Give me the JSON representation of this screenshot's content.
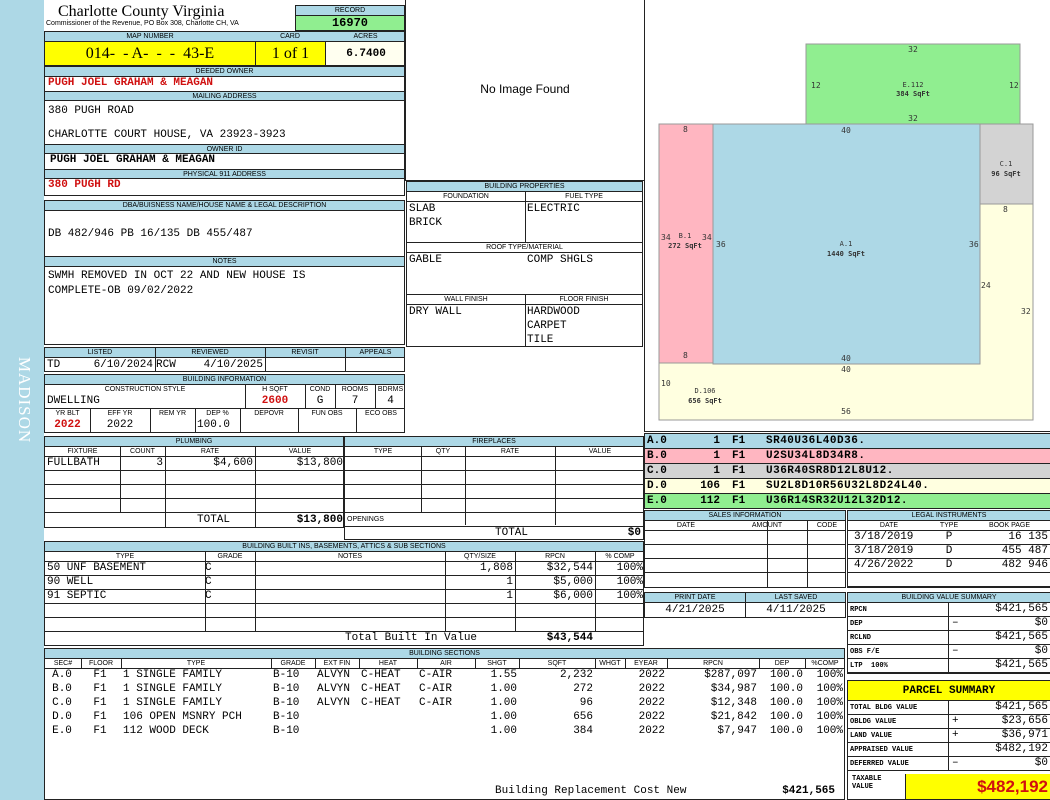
{
  "sidebar": {
    "district": "MADISON"
  },
  "header": {
    "county": "Charlotte County Virginia",
    "office": "Commissioner of the Revenue, PO Box 308, Charlotte CH, VA",
    "record_label": "RECORD",
    "record": "16970",
    "map_label": "MAP NUMBER",
    "map": "014-  - A-  -  -  43-E",
    "card_label": "CARD",
    "card": "1 of 1",
    "acres_label": "ACRES",
    "acres": "6.7400"
  },
  "owner": {
    "deeded_label": "DEEDED OWNER",
    "deeded": "PUGH JOEL GRAHAM & MEAGAN",
    "mailing_label": "MAILING ADDRESS",
    "mail1": "380 PUGH ROAD",
    "mail2": "CHARLOTTE COURT HOUSE, VA 23923-3923",
    "owner_id_label": "OWNER ID",
    "owner_id": "PUGH JOEL GRAHAM & MEAGAN",
    "physical_label": "PHYSICAL 911 ADDRESS",
    "physical": "380 PUGH RD"
  },
  "legal": {
    "label": "DBA/BUISNESS NAME/HOUSE NAME & LEGAL DESCRIPTION",
    "text": "DB 482/946 PB 16/135 DB 455/487"
  },
  "notes": {
    "label": "NOTES",
    "line1": "SWMH REMOVED IN OCT 22 AND NEW HOUSE IS",
    "line2": "COMPLETE-OB 09/02/2022"
  },
  "image": {
    "text": "No Image Found"
  },
  "building_props": {
    "label": "BUILDING PROPERTIES",
    "foundation_label": "FOUNDATION",
    "fuel_label": "FUEL TYPE",
    "foundation1": "SLAB",
    "foundation2": "BRICK",
    "fuel": "ELECTRIC",
    "roof_label": "ROOF TYPE/MATERIAL",
    "roof_type": "GABLE",
    "roof_mat": "COMP SHGLS",
    "wall_label": "WALL FINISH",
    "floor_label": "FLOOR FINISH",
    "wall": "DRY WALL",
    "floor1": "HARDWOOD",
    "floor2": "CARPET",
    "floor3": "TILE"
  },
  "listing": {
    "listed_label": "LISTED",
    "reviewed_label": "REVIEWED",
    "revisit_label": "REVISIT",
    "appeals_label": "APPEALS",
    "listed_by": "TD",
    "listed_date": "6/10/2024",
    "reviewed_by": "RCW",
    "reviewed_date": "4/10/2025"
  },
  "building_info": {
    "label": "BUILDING INFORMATION",
    "style_label": "CONSTRUCTION STYLE",
    "hsqft_label": "H SQFT",
    "cond_label": "COND",
    "rooms_label": "ROOMS",
    "bdrms_label": "BDRMS",
    "style": "DWELLING",
    "hsqft": "2600",
    "cond": "G",
    "rooms": "7",
    "bdrms": "4",
    "yrblt_label": "YR BLT",
    "effyr_label": "EFF YR",
    "remyr_label": "REM YR",
    "dep_label": "DEP %",
    "depovr_label": "DEPOVR",
    "funobs_label": "FUN OBS",
    "ecoobs_label": "ECO OBS",
    "yrblt": "2022",
    "effyr": "2022",
    "dep": "100.0"
  },
  "plumbing": {
    "label": "PLUMBING",
    "cols": [
      "FIXTURE",
      "COUNT",
      "RATE",
      "VALUE"
    ],
    "rows": [
      [
        "FULLBATH",
        "3",
        "$4,600",
        "$13,800"
      ]
    ],
    "total_label": "TOTAL",
    "total": "$13,800"
  },
  "fireplaces": {
    "label": "FIREPLACES",
    "cols": [
      "TYPE",
      "QTY",
      "RATE",
      "VALUE"
    ],
    "openings_label": "OPENINGS",
    "total_label": "TOTAL",
    "total": "$0"
  },
  "builtins": {
    "label": "BUILDING BUILT INS, BASEMENTS, ATTICS & SUB SECTIONS",
    "cols": [
      "TYPE",
      "GRADE",
      "NOTES",
      "QTY/SIZE",
      "RPCN",
      "% COMP"
    ],
    "rows": [
      [
        "50 UNF BASEMENT",
        "C",
        "",
        "1,808",
        "$32,544",
        "100%"
      ],
      [
        "90 WELL",
        "C",
        "",
        "1",
        "$5,000",
        "100%"
      ],
      [
        "91 SEPTIC",
        "C",
        "",
        "1",
        "$6,000",
        "100%"
      ]
    ],
    "total_label": "Total Built In Value",
    "total": "$43,544"
  },
  "sections": {
    "label": "BUILDING SECTIONS",
    "cols": [
      "SEC#",
      "FLOOR",
      "TYPE",
      "GRADE",
      "EXT FIN",
      "HEAT",
      "AIR",
      "SHGT",
      "SQFT",
      "WHGT",
      "EYEAR",
      "RPCN",
      "DEP",
      "%COMP"
    ],
    "rows": [
      [
        "A.0",
        "F1",
        "1 SINGLE FAMILY",
        "B-10",
        "ALVYN",
        "C-HEAT",
        "C-AIR",
        "1.55",
        "2,232",
        "",
        "2022",
        "$287,097",
        "100.0",
        "100%"
      ],
      [
        "B.0",
        "F1",
        "1 SINGLE FAMILY",
        "B-10",
        "ALVYN",
        "C-HEAT",
        "C-AIR",
        "1.00",
        "272",
        "",
        "2022",
        "$34,987",
        "100.0",
        "100%"
      ],
      [
        "C.0",
        "F1",
        "1 SINGLE FAMILY",
        "B-10",
        "ALVYN",
        "C-HEAT",
        "C-AIR",
        "1.00",
        "96",
        "",
        "2022",
        "$12,348",
        "100.0",
        "100%"
      ],
      [
        "D.0",
        "F1",
        "106 OPEN MSNRY PCH",
        "B-10",
        "",
        "",
        "",
        "1.00",
        "656",
        "",
        "2022",
        "$21,842",
        "100.0",
        "100%"
      ],
      [
        "E.0",
        "F1",
        "112 WOOD DECK",
        "B-10",
        "",
        "",
        "",
        "1.00",
        "384",
        "",
        "2022",
        "$7,947",
        "100.0",
        "100%"
      ]
    ],
    "total_label": "Building Replacement Cost New",
    "total": "$421,565"
  },
  "sketch": {
    "areas": [
      {
        "id": "A.1",
        "sqft": "1440 SqFt",
        "color": "#add8e6",
        "dims": [
          "40",
          "36",
          "40",
          "36"
        ]
      },
      {
        "id": "B.1",
        "sqft": "272 SqFt",
        "color": "#ffb6c1",
        "dims": [
          "8",
          "34",
          "8",
          "34"
        ]
      },
      {
        "id": "C.1",
        "sqft": "96 SqFt",
        "color": "#d3d3d3",
        "dims": [
          "8"
        ]
      },
      {
        "id": "D.106",
        "sqft": "656 SqFt",
        "color": "#ffffe0",
        "dims": [
          "40",
          "24",
          "32",
          "56",
          "10",
          "2"
        ]
      },
      {
        "id": "E.112",
        "sqft": "384 SqFt",
        "color": "#90ee90",
        "dims": [
          "32",
          "12",
          "32",
          "12"
        ]
      }
    ],
    "codes": [
      {
        "sec": "A.0",
        "num": "1",
        "fl": "F1",
        "path": "SR40U36L40D36.",
        "color": "#add8e6"
      },
      {
        "sec": "B.0",
        "num": "1",
        "fl": "F1",
        "path": "U2SU34L8D34R8.",
        "color": "#ffb6c1"
      },
      {
        "sec": "C.0",
        "num": "1",
        "fl": "F1",
        "path": "U36R40SR8D12L8U12.",
        "color": "#d3d3d3"
      },
      {
        "sec": "D.0",
        "num": "106",
        "fl": "F1",
        "path": "SU2L8D10R56U32L8D24L40.",
        "color": "#ffffe0"
      },
      {
        "sec": "E.0",
        "num": "112",
        "fl": "F1",
        "path": "U36R14SR32U12L32D12.",
        "color": "#90ee90"
      }
    ]
  },
  "sales": {
    "label": "SALES INFORMATION",
    "cols": [
      "DATE",
      "AMOUNT",
      "CODE"
    ]
  },
  "legal_instr": {
    "label": "LEGAL INSTRUMENTS",
    "cols": [
      "DATE",
      "TYPE",
      "BOOK PAGE"
    ],
    "rows": [
      [
        "3/18/2019",
        "P",
        "16 135"
      ],
      [
        "3/18/2019",
        "D",
        "455 487"
      ],
      [
        "4/26/2022",
        "D",
        "482 946"
      ]
    ]
  },
  "dates": {
    "print_label": "PRINT DATE",
    "saved_label": "LAST SAVED",
    "print": "4/21/2025",
    "saved": "4/11/2025"
  },
  "bvs": {
    "label": "BUILDING VALUE SUMMARY",
    "rows": [
      [
        "RPCN",
        "",
        "$421,565"
      ],
      [
        "DEP",
        "–",
        "$0"
      ],
      [
        "RCLND",
        "",
        "$421,565"
      ],
      [
        "OBS F/E",
        "–",
        "$0"
      ],
      [
        "LTP  100%",
        "",
        "$421,565"
      ]
    ]
  },
  "parcel": {
    "label": "PARCEL SUMMARY",
    "rows": [
      [
        "TOTAL BLDG VALUE",
        "",
        "$421,565"
      ],
      [
        "OBLDG VALUE",
        "+",
        "$23,656"
      ],
      [
        "LAND VALUE",
        "+",
        "$36,971"
      ],
      [
        "APPRAISED VALUE",
        "",
        "$482,192"
      ],
      [
        "DEFERRED VALUE",
        "–",
        "$0"
      ]
    ],
    "taxable_label": "TAXABLE VALUE",
    "taxable": "$482,192"
  }
}
